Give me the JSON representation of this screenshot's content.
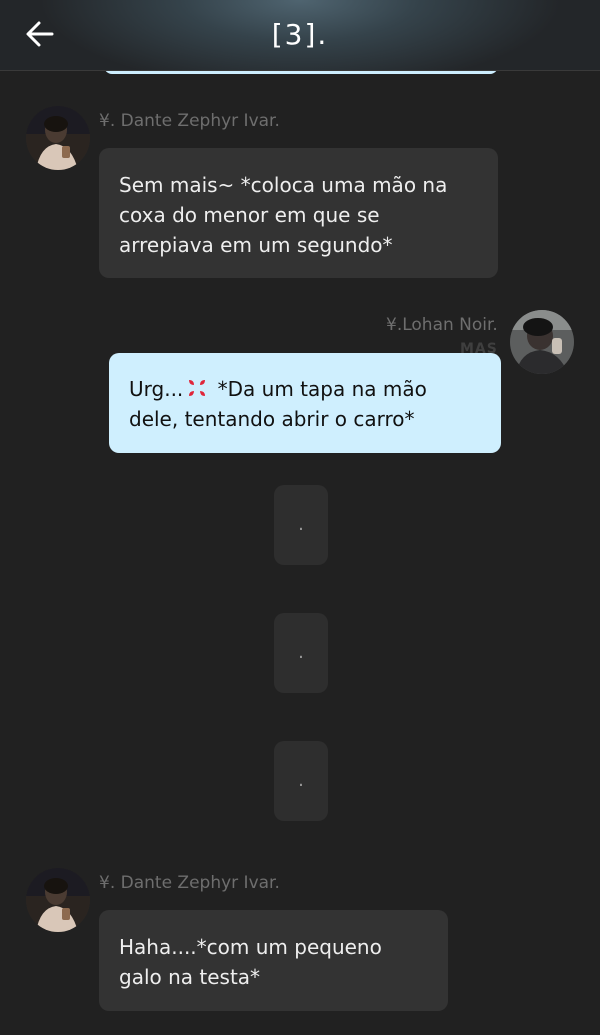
{
  "header": {
    "title": "[3].",
    "back_icon": "arrow-left-icon"
  },
  "messages": [
    {
      "sender": "¥. Dante Zephyr Ivar.",
      "direction": "incoming",
      "text": "Sem mais~ *coloca uma mão na coxa do menor em que se arrepiava em um segundo*"
    },
    {
      "sender": "¥.Lohan Noir.",
      "direction": "outgoing",
      "text_before_emoji": "Urg...",
      "emoji": "anger-symbol-icon",
      "text_after_emoji": " *Da um tapa na mão dele, tentando abrir o carro*"
    },
    {
      "direction": "incoming",
      "text": "."
    },
    {
      "direction": "incoming",
      "text": "."
    },
    {
      "direction": "incoming",
      "text": "."
    },
    {
      "sender": "¥. Dante Zephyr Ivar.",
      "direction": "incoming",
      "text": "Haha....*com um pequeno galo na testa*"
    }
  ],
  "watermark": "MAS",
  "colors": {
    "background": "#212121",
    "incoming_bubble": "#333333",
    "outgoing_bubble": "#cfeffe",
    "name_text": "#6e6e6e"
  }
}
